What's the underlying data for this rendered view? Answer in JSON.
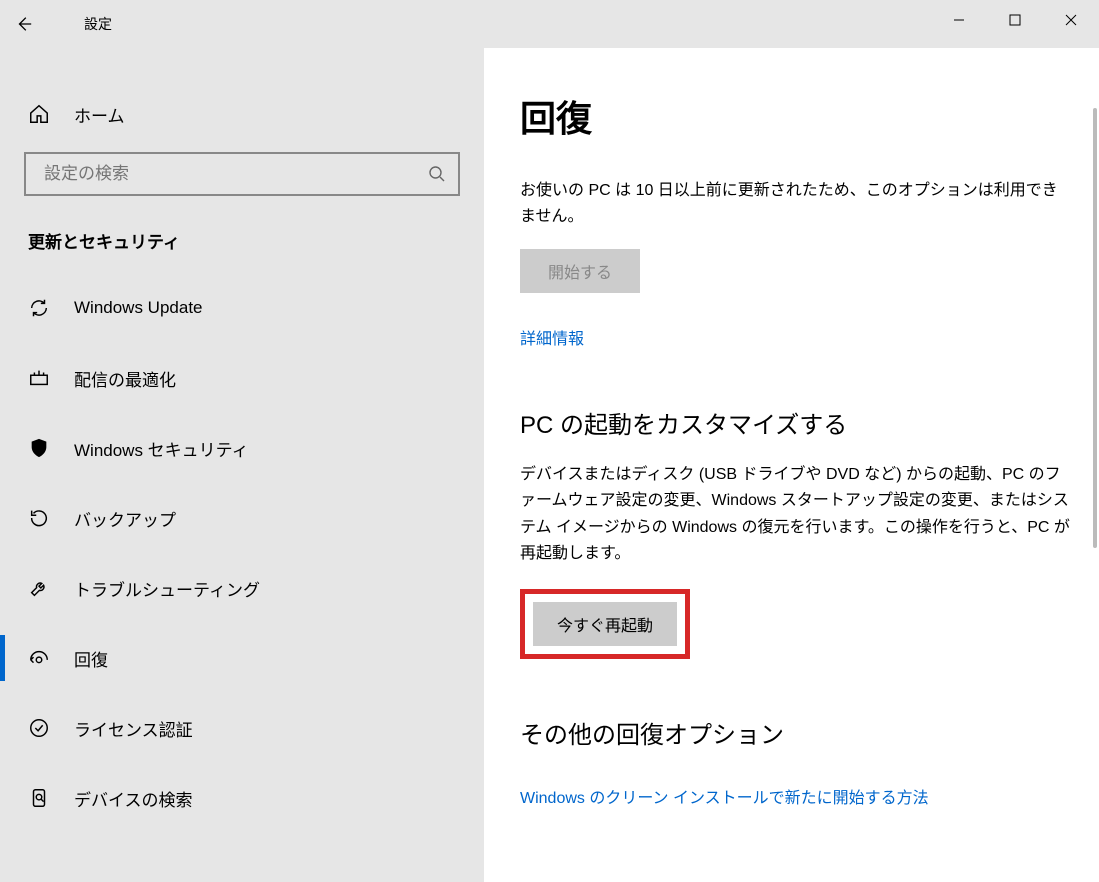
{
  "titlebar": {
    "title": "設定"
  },
  "sidebar": {
    "home": "ホーム",
    "search_placeholder": "設定の検索",
    "category": "更新とセキュリティ",
    "items": [
      {
        "label": "Windows Update",
        "icon": "refresh-icon"
      },
      {
        "label": "配信の最適化",
        "icon": "delivery-icon"
      },
      {
        "label": "Windows セキュリティ",
        "icon": "shield-icon"
      },
      {
        "label": "バックアップ",
        "icon": "backup-icon"
      },
      {
        "label": "トラブルシューティング",
        "icon": "wrench-icon"
      },
      {
        "label": "回復",
        "icon": "recovery-icon",
        "active": true
      },
      {
        "label": "ライセンス認証",
        "icon": "activation-icon"
      },
      {
        "label": "デバイスの検索",
        "icon": "findmy-icon"
      }
    ]
  },
  "main": {
    "heading": "回復",
    "reset": {
      "desc": "お使いの PC は 10 日以上前に更新されたため、このオプションは利用できません。",
      "button": "開始する"
    },
    "more_info_link": "詳細情報",
    "advanced": {
      "heading": "PC の起動をカスタマイズする",
      "desc": "デバイスまたはディスク (USB ドライブや DVD など) からの起動、PC のファームウェア設定の変更、Windows スタートアップ設定の変更、またはシステム イメージからの Windows の復元を行います。この操作を行うと、PC が再起動します。",
      "button": "今すぐ再起動"
    },
    "other": {
      "heading": "その他の回復オプション",
      "link": "Windows のクリーン インストールで新たに開始する方法"
    }
  }
}
